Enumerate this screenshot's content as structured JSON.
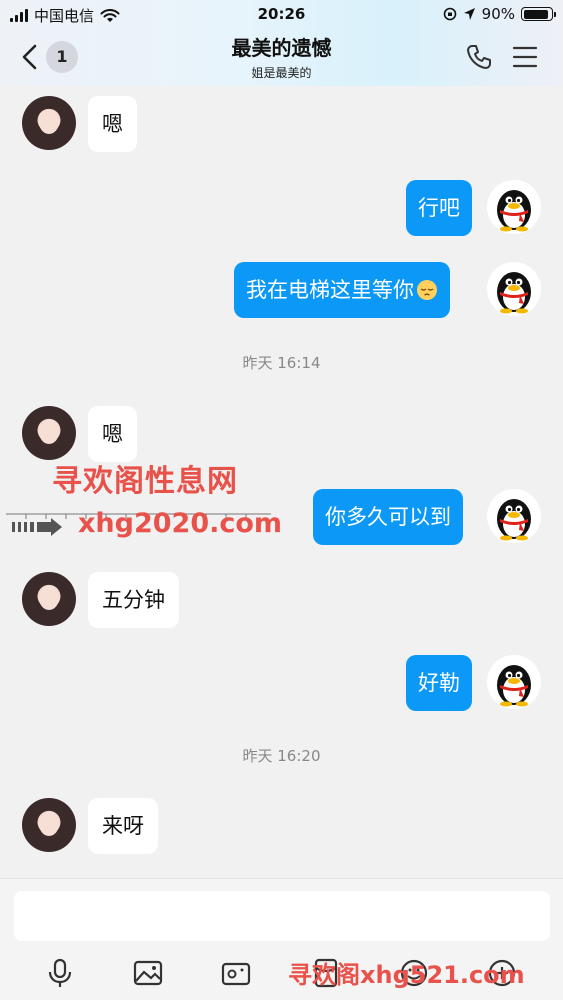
{
  "status_bar": {
    "carrier": "中国电信",
    "time": "20:26",
    "battery_percent": "90%",
    "battery_level": 0.9
  },
  "nav": {
    "unread_count": "1",
    "title": "最美的遗憾",
    "subtitle": "姐是最美的"
  },
  "messages": [
    {
      "side": "in",
      "text": "嗯"
    },
    {
      "side": "out",
      "text": "行吧"
    },
    {
      "side": "out",
      "text": "我在电梯这里等你",
      "emoji": "sleepy-face"
    },
    {
      "timestamp": "昨天 16:14"
    },
    {
      "side": "in",
      "text": "嗯"
    },
    {
      "side": "out",
      "text": "你多久可以到"
    },
    {
      "side": "in",
      "text": "五分钟"
    },
    {
      "side": "out",
      "text": "好勒"
    },
    {
      "timestamp": "昨天 16:20"
    },
    {
      "side": "in",
      "text": "来呀"
    }
  ],
  "watermark": {
    "line1": "寻欢阁性息网",
    "line2": "xhg2020.com",
    "bottom": "寻欢阁xhg521.com"
  },
  "input": {
    "placeholder": ""
  },
  "colors": {
    "outgoing_bubble": "#0b98f7",
    "incoming_bubble": "#ffffff",
    "watermark": "#e8524a"
  }
}
